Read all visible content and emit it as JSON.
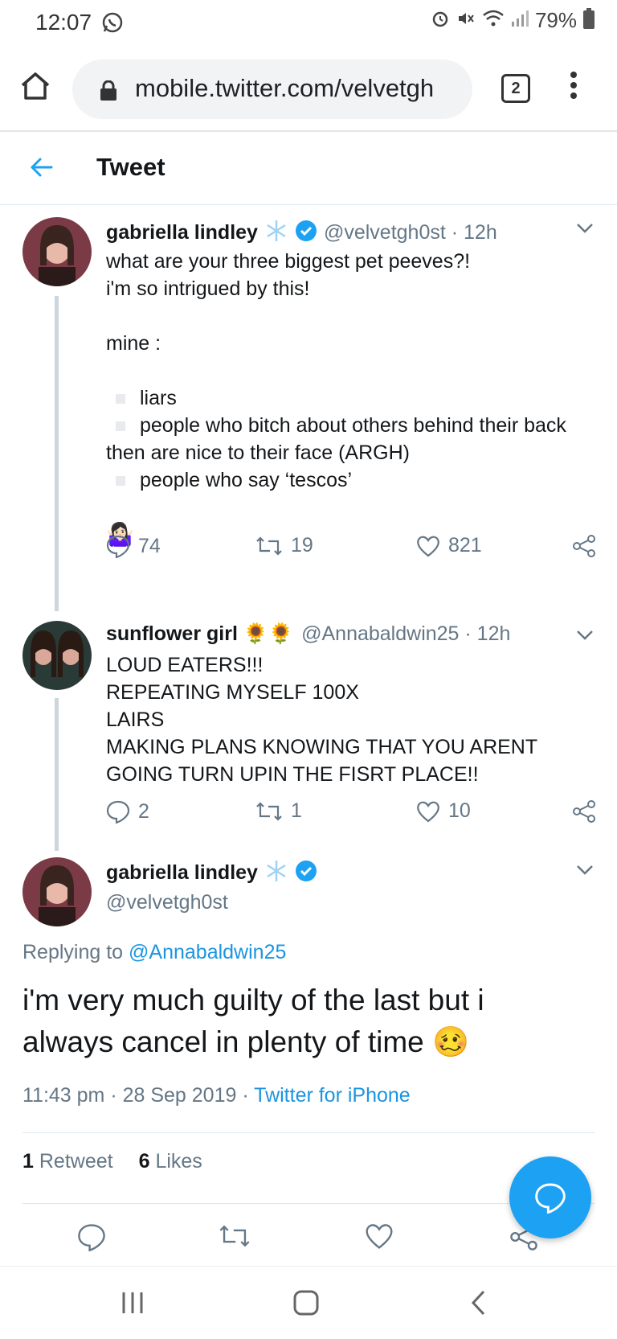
{
  "status_bar": {
    "time": "12:07",
    "battery": "79%"
  },
  "browser": {
    "url": "mobile.twitter.com/velvetgh",
    "tab_count": "2"
  },
  "header": {
    "title": "Tweet"
  },
  "tweet1": {
    "name": "gabriella lindley",
    "handle_time": "@velvetgh0st · 12h",
    "lines": [
      "what are your three biggest pet peeves?!",
      "i'm so intrigued by this!"
    ],
    "mine": "mine :",
    "bullets": [
      "liars",
      "people who bitch about others behind their back",
      "people who say ‘tescos’"
    ],
    "continuation": "then are nice to their face (ARGH)",
    "emoji": "🤷🏻‍♀️",
    "replies": "74",
    "retweets": "19",
    "likes": "821"
  },
  "tweet2": {
    "name": "sunflower girl 🌻🌻",
    "handle_time": "@Annabaldwin25 · 12h",
    "lines": [
      "LOUD EATERS!!!",
      "REPEATING MYSELF 100X",
      "LAIRS",
      "MAKING PLANS KNOWING THAT YOU ARENT",
      "GOING TURN UPIN THE FISRT PLACE!!"
    ],
    "replies": "2",
    "retweets": "1",
    "likes": "10"
  },
  "tweet3": {
    "name": "gabriella lindley",
    "handle": "@velvetgh0st",
    "replying_prefix": "Replying to",
    "replying_to": "@Annabaldwin25",
    "line1": "i'm very much guilty of the last but i",
    "line2": "always cancel in plenty of time",
    "emoji": "🥴",
    "timestamp": "11:43 pm · 28 Sep 2019 ·",
    "source": "Twitter for iPhone",
    "retweet_count": "1",
    "retweet_label": "Retweet",
    "like_count": "6",
    "like_label": "Likes"
  },
  "icons": {
    "accent": "#1da1f2",
    "verified": "#1da1f2"
  }
}
